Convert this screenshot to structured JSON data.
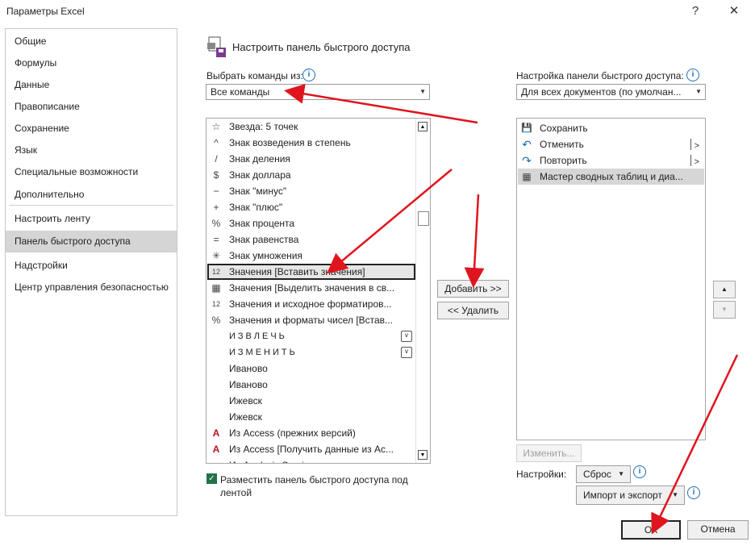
{
  "window": {
    "title": "Параметры Excel",
    "help_glyph": "?",
    "close_glyph": "✕"
  },
  "nav": {
    "items": [
      {
        "label": "Общие"
      },
      {
        "label": "Формулы"
      },
      {
        "label": "Данные"
      },
      {
        "label": "Правописание"
      },
      {
        "label": "Сохранение"
      },
      {
        "label": "Язык"
      },
      {
        "label": "Специальные возможности"
      },
      {
        "label": "Дополнительно"
      },
      {
        "label": "Настроить ленту"
      },
      {
        "label": "Панель быстрого доступа",
        "selected": true
      },
      {
        "label": "Надстройки"
      },
      {
        "label": "Центр управления безопасностью"
      }
    ]
  },
  "header": {
    "title": "Настроить панель быстрого доступа"
  },
  "left": {
    "choose_label": "Выбрать команды из:",
    "choose_value": "Все команды",
    "commands": [
      {
        "icon": "☆",
        "icon_name": "star-icon",
        "label": "Звезда: 5 точек"
      },
      {
        "icon": "^",
        "icon_name": "caret-icon",
        "label": "Знак возведения в степень"
      },
      {
        "icon": "/",
        "icon_name": "slash-icon",
        "label": "Знак деления"
      },
      {
        "icon": "$",
        "icon_name": "dollar-icon",
        "label": "Знак доллара"
      },
      {
        "icon": "−",
        "icon_name": "minus-icon",
        "label": "Знак \"минус\""
      },
      {
        "icon": "+",
        "icon_name": "plus-icon",
        "label": "Знак \"плюс\""
      },
      {
        "icon": "%",
        "icon_name": "percent-icon",
        "label": "Знак процента"
      },
      {
        "icon": "=",
        "icon_name": "equals-icon",
        "label": "Знак равенства"
      },
      {
        "icon": "✳",
        "icon_name": "asterisk-icon",
        "label": "Знак умножения"
      },
      {
        "icon": "12",
        "icon_name": "paste-values-icon",
        "label": "Значения [Вставить значения]",
        "selected": true
      },
      {
        "icon": "▦",
        "icon_name": "select-values-icon",
        "label": "Значения [Выделить значения в св..."
      },
      {
        "icon": "12",
        "icon_name": "values-format-icon",
        "label": "Значения и исходное форматиров..."
      },
      {
        "icon": "%",
        "icon_name": "values-number-format-icon",
        "label": "Значения и форматы чисел [Встав..."
      },
      {
        "icon": "",
        "icon_name": "",
        "label": "ИЗВЛЕЧЬ",
        "spaced": true,
        "expander": true
      },
      {
        "icon": "",
        "icon_name": "",
        "label": "ИЗМЕНИТЬ",
        "spaced": true,
        "expander": true
      },
      {
        "icon": "",
        "icon_name": "",
        "label": "Иваново"
      },
      {
        "icon": "",
        "icon_name": "",
        "label": "Иваново"
      },
      {
        "icon": "",
        "icon_name": "",
        "label": "Ижевск"
      },
      {
        "icon": "",
        "icon_name": "",
        "label": "Ижевск"
      },
      {
        "icon": "A",
        "icon_name": "access-icon",
        "label": "Из Access (прежних версий)"
      },
      {
        "icon": "A",
        "icon_name": "access-icon",
        "label": "Из Access [Получить данные из Ac..."
      },
      {
        "icon": "",
        "icon_name": "",
        "label": "Из Analysis Services"
      }
    ],
    "place_below_label": "Разместить панель быстрого доступа под лентой",
    "place_below_checked": true
  },
  "middle": {
    "add_label": "Добавить >>",
    "remove_label": "<< Удалить"
  },
  "right": {
    "customize_label": "Настройка панели быстрого доступа:",
    "customize_value": "Для всех документов (по умолчан...",
    "items": [
      {
        "icon": "💾",
        "icon_name": "save-icon",
        "label": "Сохранить"
      },
      {
        "icon": "↶",
        "icon_name": "undo-icon",
        "label": "Отменить",
        "submenu": true
      },
      {
        "icon": "↷",
        "icon_name": "redo-icon",
        "label": "Повторить",
        "submenu": true
      },
      {
        "icon": "▦",
        "icon_name": "pivot-wizard-icon",
        "label": "Мастер сводных таблиц и диа...",
        "highlighted": true
      }
    ],
    "modify_label": "Изменить...",
    "settings_label": "Настройки:",
    "reset_label": "Сброс",
    "import_export_label": "Импорт и экспорт"
  },
  "footer": {
    "ok_label": "ОК",
    "cancel_label": "Отмена"
  },
  "colors": {
    "accent": "#1f6fb5",
    "checkbox": "#217346",
    "annotation": "#e0141e",
    "selection": "#d5d5d5"
  }
}
